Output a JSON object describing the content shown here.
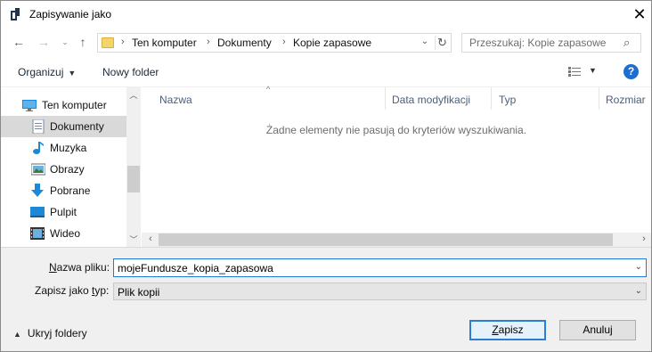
{
  "window": {
    "title": "Zapisywanie jako",
    "close_icon": "close-icon"
  },
  "nav": {
    "back_icon": "arrow-left-icon",
    "forward_icon": "arrow-right-icon",
    "recent_icon": "chevron-down-icon",
    "up_icon": "arrow-up-icon",
    "breadcrumbs": [
      "Ten komputer",
      "Dokumenty",
      "Kopie zapasowe"
    ],
    "search_placeholder": "Przeszukaj: Kopie zapasowe"
  },
  "toolbar": {
    "organize_label": "Organizuj",
    "new_folder_label": "Nowy folder",
    "help_label": "?"
  },
  "sidebar": {
    "items": [
      {
        "label": "Ten komputer",
        "icon": "computer-icon"
      },
      {
        "label": "Dokumenty",
        "icon": "documents-icon",
        "selected": true
      },
      {
        "label": "Muzyka",
        "icon": "music-icon"
      },
      {
        "label": "Obrazy",
        "icon": "pictures-icon"
      },
      {
        "label": "Pobrane",
        "icon": "downloads-icon"
      },
      {
        "label": "Pulpit",
        "icon": "desktop-icon"
      },
      {
        "label": "Wideo",
        "icon": "video-icon"
      }
    ]
  },
  "filelist": {
    "columns": [
      "Nazwa",
      "Data modyfikacji",
      "Typ",
      "Rozmiar"
    ],
    "empty_message": "Żadne elementy nie pasują do kryteriów wyszukiwania."
  },
  "form": {
    "filename_label_pre": "",
    "filename_label_u": "N",
    "filename_label_post": "azwa pliku:",
    "filename_value": "mojeFundusze_kopia_zapasowa",
    "type_label_pre": "Zapisz jako ",
    "type_label_u": "t",
    "type_label_post": "yp:",
    "type_value": "Plik kopii"
  },
  "footer": {
    "hide_folders_label": "Ukryj foldery",
    "save_u": "Z",
    "save_rest": "apisz",
    "cancel_label": "Anuluj"
  },
  "colors": {
    "accent": "#1f7ad6",
    "selected_bg": "#d9d9d9",
    "help_blue": "#1c6fd0"
  }
}
